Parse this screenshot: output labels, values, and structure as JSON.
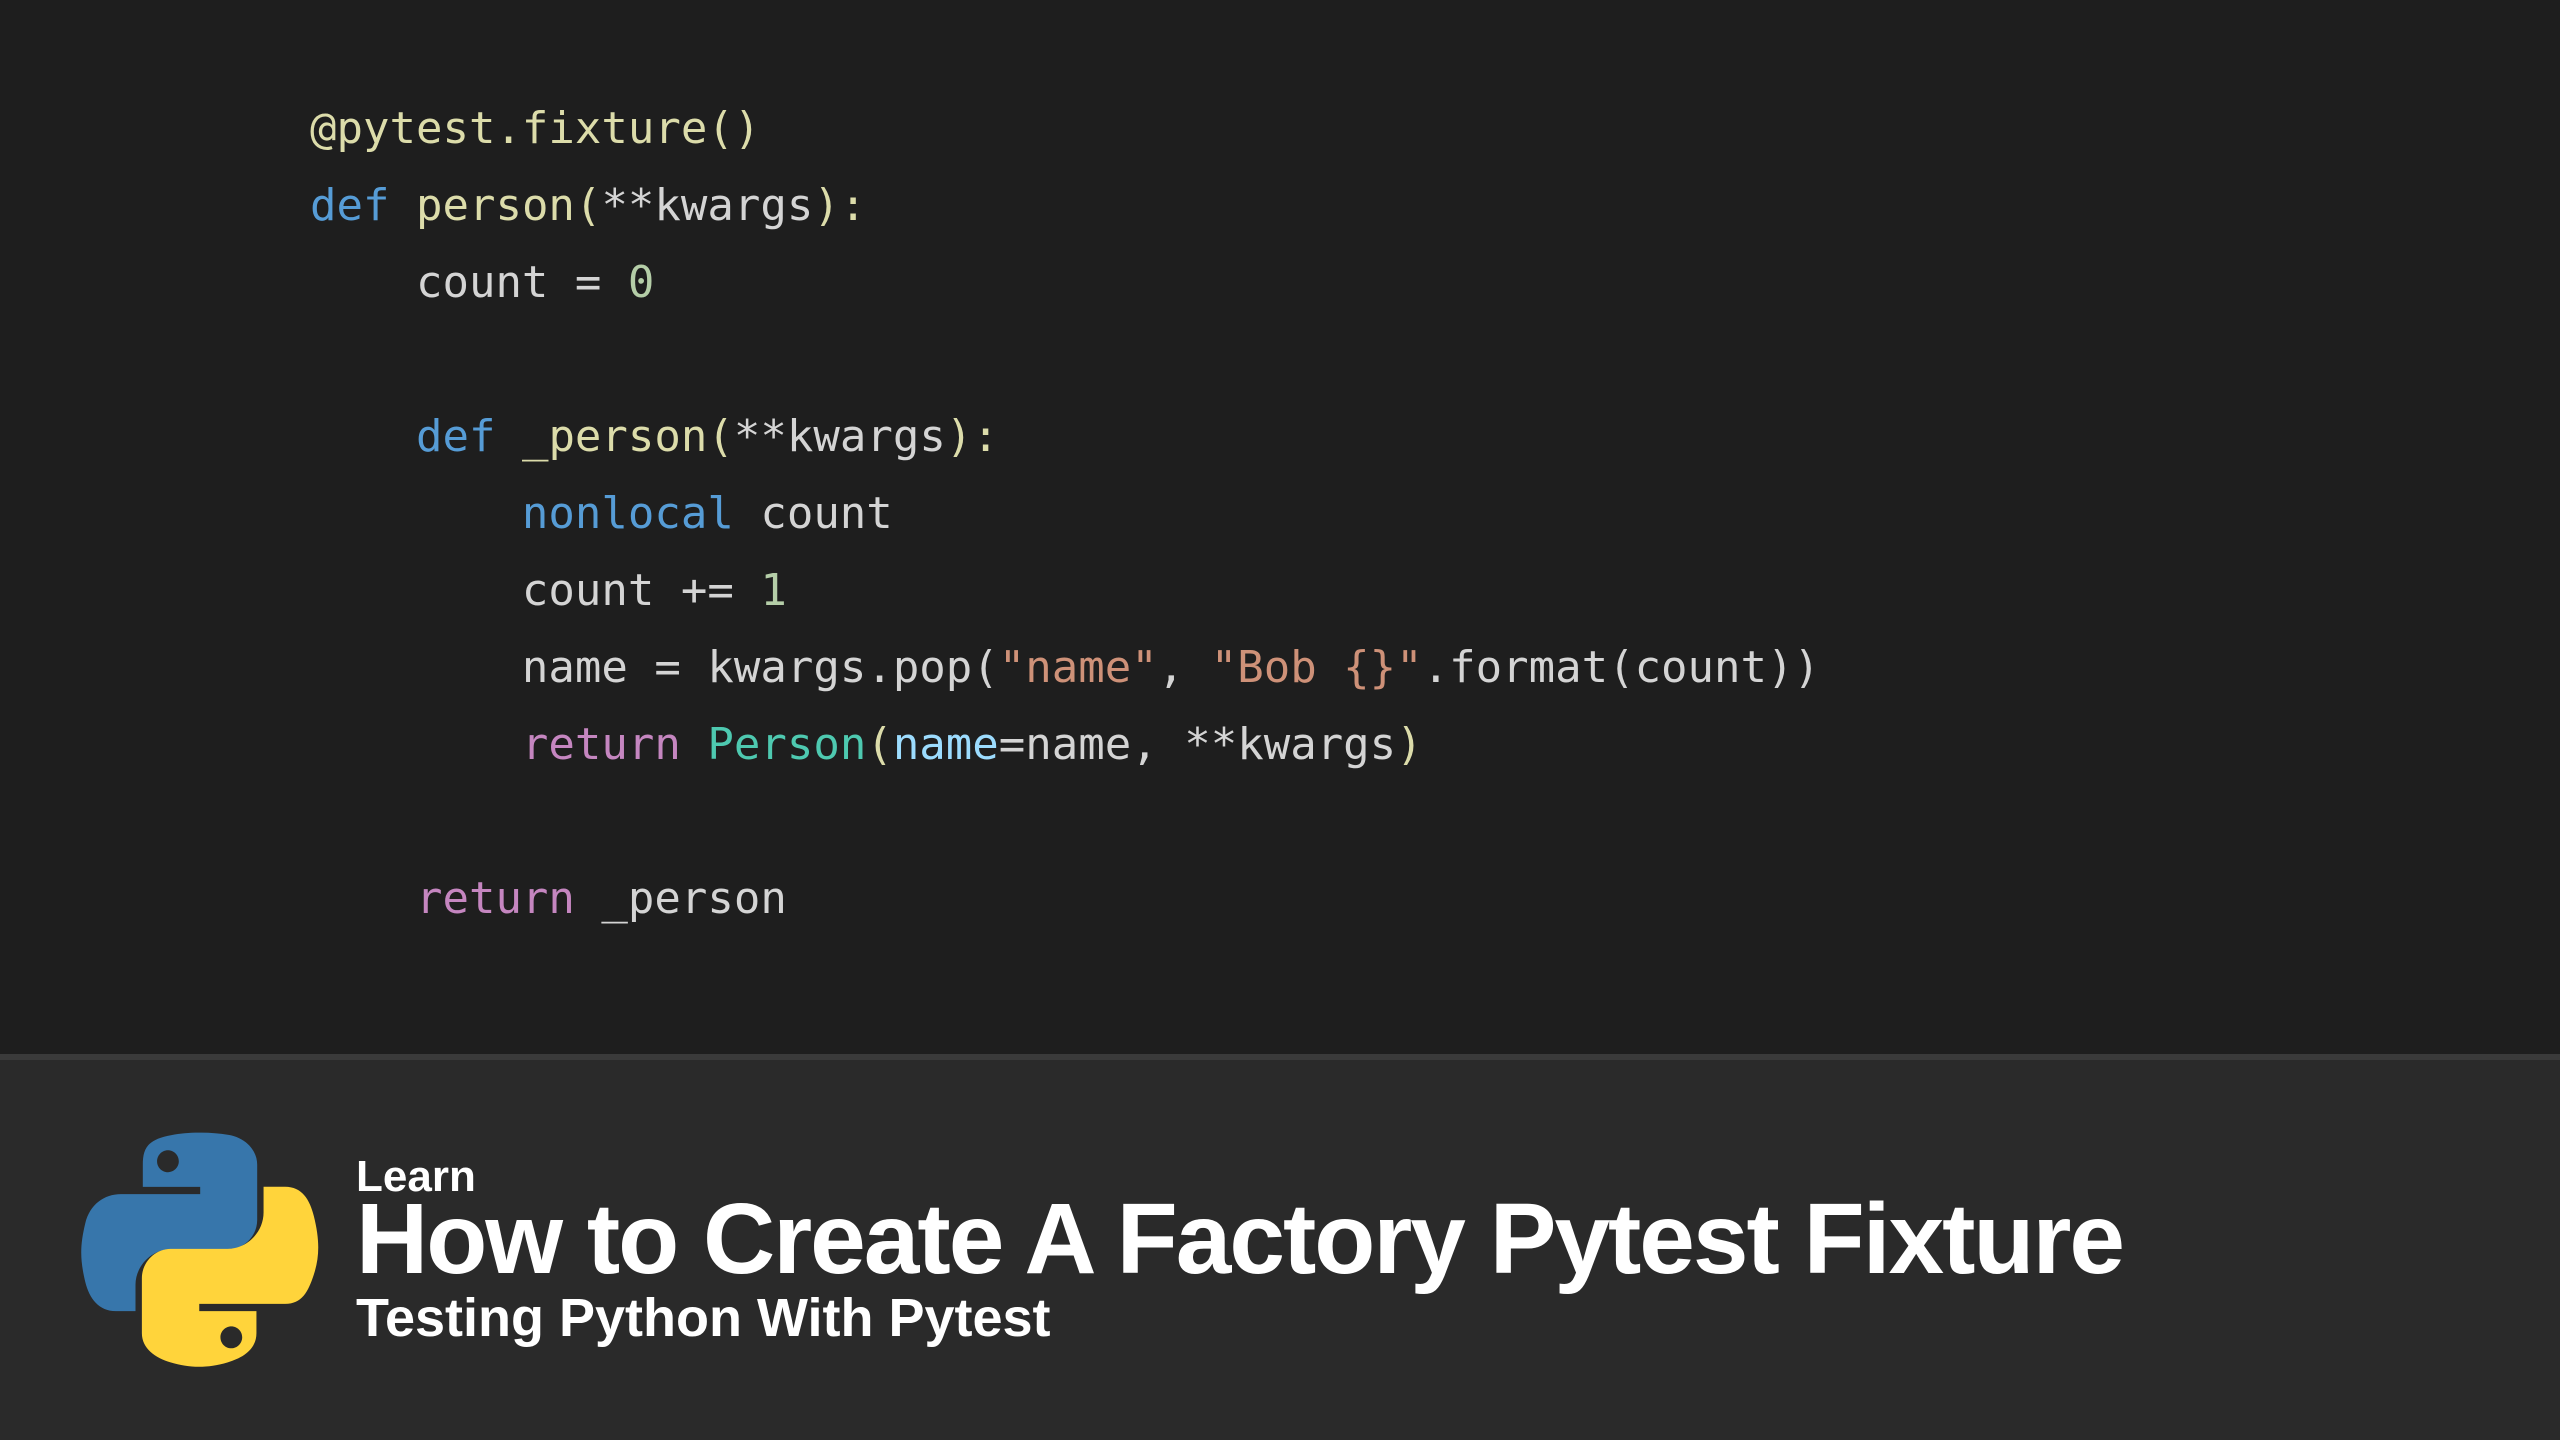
{
  "code": {
    "line1_decorator": "@pytest.fixture",
    "line1_call": "()",
    "line2_def": "def",
    "line2_name": "person",
    "line2_params_open": "(",
    "line2_stars": "**",
    "line2_kwargs": "kwargs",
    "line2_params_close": "):",
    "line3_count": "count",
    "line3_eq": " = ",
    "line3_zero": "0",
    "line4_def": "def",
    "line4_name": "_person",
    "line4_open": "(",
    "line4_stars": "**",
    "line4_kwargs": "kwargs",
    "line4_close": "):",
    "line5_nonlocal": "nonlocal",
    "line5_count": " count",
    "line6_count": "count",
    "line6_pluseq": " += ",
    "line6_one": "1",
    "line7_name": "name",
    "line7_eq": " = ",
    "line7_kwargs": "kwargs",
    "line7_pop": ".pop(",
    "line7_str1": "\"name\"",
    "line7_comma": ", ",
    "line7_str2": "\"Bob {}\"",
    "line7_format": ".format(count))",
    "line8_return": "return",
    "line8_class": " Person",
    "line8_open": "(",
    "line8_arg": "name",
    "line8_eq": "=",
    "line8_val": "name",
    "line8_comma": ", ",
    "line8_stars": "**",
    "line8_kwargs": "kwargs",
    "line8_close": ")",
    "line9_return": "return",
    "line9_val": " _person"
  },
  "banner": {
    "eyebrow": "Learn",
    "title": "How to Create A Factory Pytest Fixture",
    "subtitle": "Testing Python With Pytest"
  },
  "colors": {
    "python_blue": "#3776ab",
    "python_yellow": "#ffd43b"
  }
}
